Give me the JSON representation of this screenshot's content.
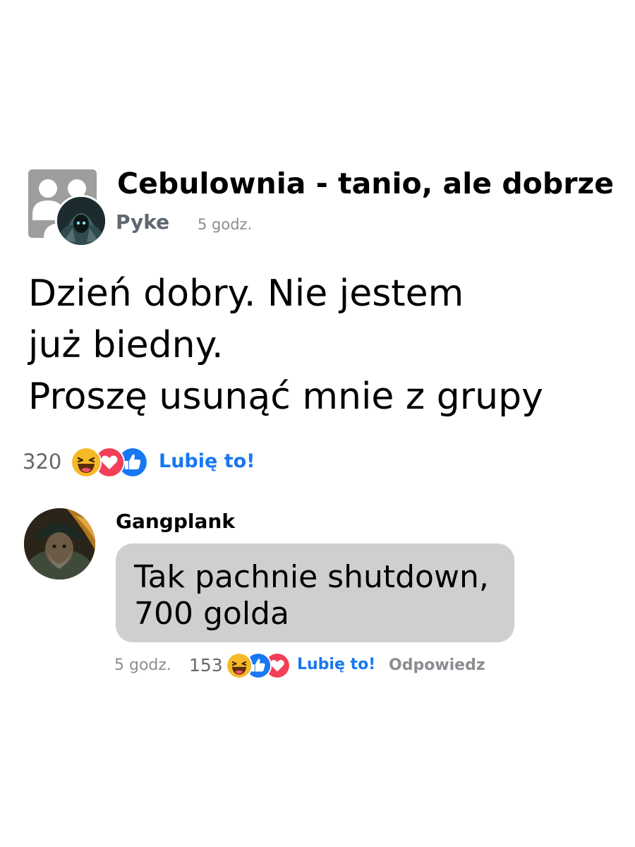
{
  "post": {
    "group_name": "Cebulownia - tanio, ale dobrze",
    "author": "Pyke",
    "time": "5 godz.",
    "text_lines": [
      "Dzień dobry. Nie jestem",
      "już biedny.",
      "Proszę usunąć mnie z grupy"
    ],
    "reaction_count": "320",
    "reactions": [
      "haha",
      "love",
      "like"
    ],
    "like_label": "Lubię to!"
  },
  "comment": {
    "author": "Gangplank",
    "text_lines": [
      "Tak pachnie shutdown,",
      "700 golda"
    ],
    "time": "5 godz.",
    "reaction_count": "153",
    "reactions": [
      "haha",
      "like",
      "love"
    ],
    "like_label": "Lubię to!",
    "reply_label": "Odpowiedz"
  },
  "colors": {
    "like_blue": "#1877f2",
    "love_pink": "#f33e58",
    "haha_yellow": "#f7b928",
    "bubble_gray": "#cfcfcf"
  }
}
